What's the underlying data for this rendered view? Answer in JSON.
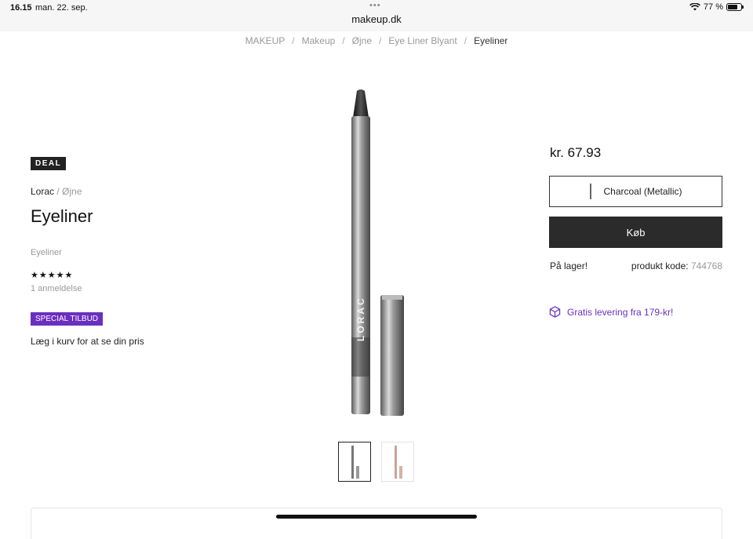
{
  "status": {
    "time": "16.15",
    "date": "man. 22. sep.",
    "url": "makeup.dk",
    "battery": "77 %",
    "battery_level": 0.77
  },
  "breadcrumb": [
    "MAKEUP",
    "Makeup",
    "Øjne",
    "Eye Liner Blyant",
    "Eyeliner"
  ],
  "product": {
    "deal_badge": "DEAL",
    "brand": "Lorac",
    "brand_sep": " / ",
    "category": "Øjne",
    "title": "Eyeliner",
    "type": "Eyeliner",
    "stars": "★★★★★",
    "rating": 5,
    "reviews": "1 anmeldelse",
    "special_badge": "SPECIAL TILBUD",
    "cart_note": "Læg i kurv for at se din pris",
    "image_brand_text": "LORAC"
  },
  "purchase": {
    "price": "kr. 67.93",
    "variant": "Charcoal (Metallic)",
    "buy_label": "Køb",
    "stock": "På lager!",
    "code_label": "produkt kode:",
    "code_value": "744768",
    "shipping": "Gratis levering fra 179-kr!"
  },
  "colors": {
    "accent": "#6b2fbf",
    "dark": "#2b2b2b",
    "muted": "#999999"
  },
  "icons": [
    "wifi-icon",
    "battery-icon",
    "box-icon"
  ]
}
